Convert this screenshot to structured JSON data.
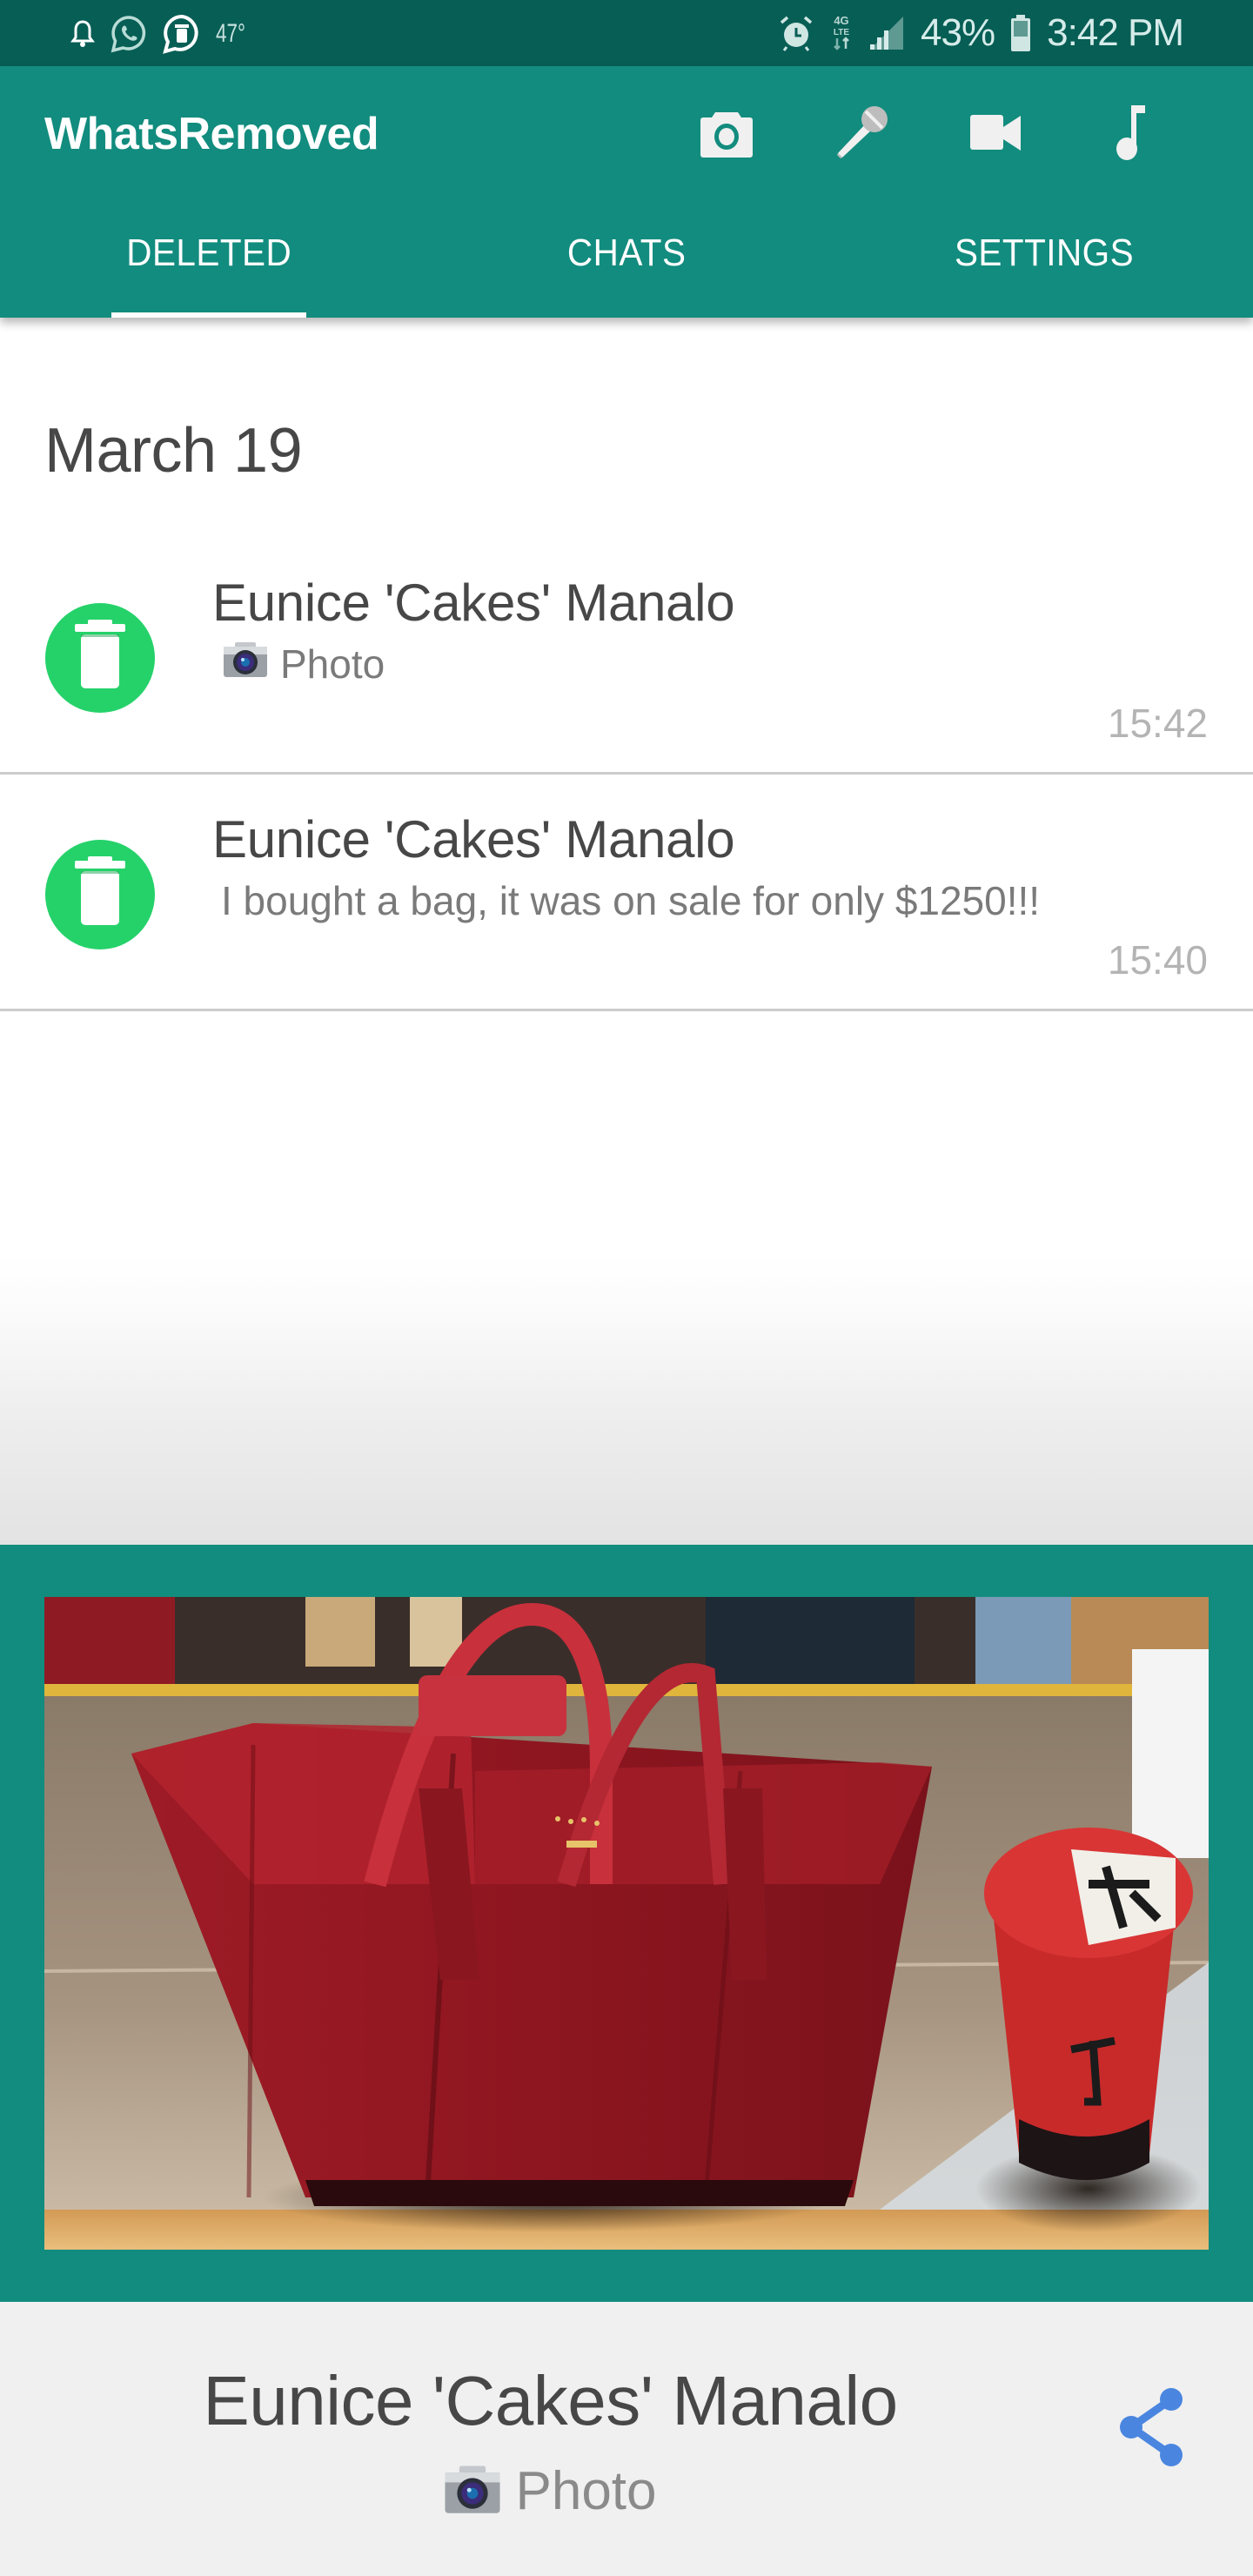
{
  "status_bar": {
    "temperature": "47°",
    "battery": "43%",
    "time": "3:42 PM",
    "network": "4G LTE",
    "left_icons": [
      "notification-bell-icon",
      "whatsapp-icon",
      "whatsremoved-icon"
    ],
    "right_icons": [
      "alarm-icon",
      "lte-icon",
      "signal-icon",
      "battery-icon"
    ]
  },
  "app_bar": {
    "title": "WhatsRemoved",
    "actions": [
      {
        "name": "camera",
        "icon": "camera-icon"
      },
      {
        "name": "microphone",
        "icon": "microphone-icon"
      },
      {
        "name": "video",
        "icon": "video-camera-icon"
      },
      {
        "name": "music",
        "icon": "music-note-icon"
      }
    ]
  },
  "tabs": [
    {
      "label": "DELETED",
      "active": true
    },
    {
      "label": "CHATS",
      "active": false
    },
    {
      "label": "SETTINGS",
      "active": false
    }
  ],
  "deleted": {
    "date_header": "March 19",
    "messages": [
      {
        "sender": "Eunice 'Cakes' Manalo",
        "preview": "Photo",
        "has_photo_icon": true,
        "time": "15:42",
        "icon": "trash-icon"
      },
      {
        "sender": "Eunice 'Cakes' Manalo",
        "preview": "I bought a bag, it was on sale for only $1250!!!",
        "has_photo_icon": false,
        "time": "15:40",
        "icon": "trash-icon"
      }
    ]
  },
  "preview": {
    "photo_description": "Red leather tote bag on a table next to an instant noodle cup",
    "sender": "Eunice 'Cakes' Manalo",
    "type_label": "Photo",
    "share_icon": "share-icon"
  },
  "colors": {
    "status_bar": "#075e55",
    "primary": "#128c7e",
    "avatar": "#25d26a",
    "share": "#4a86e0",
    "footer_bg": "#f0f0f0"
  }
}
